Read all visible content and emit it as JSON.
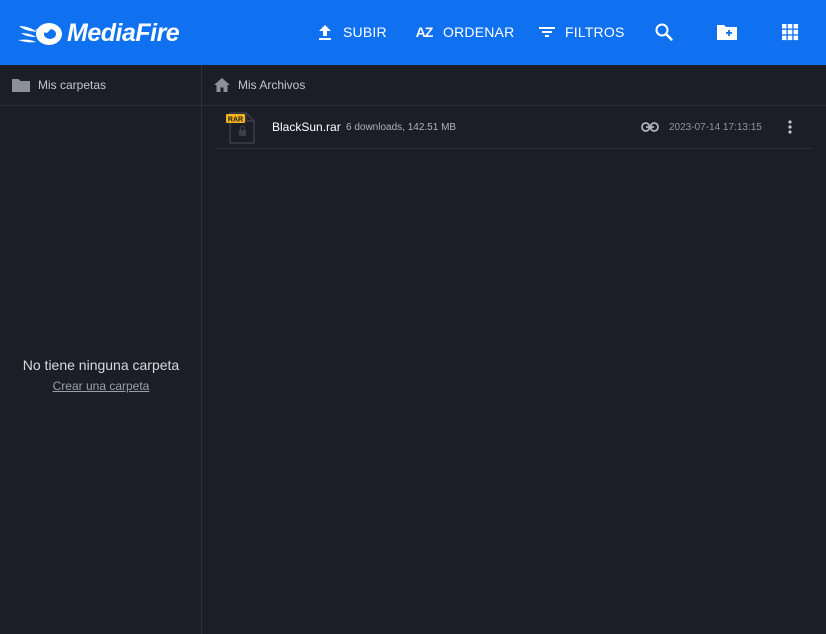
{
  "header": {
    "logo_text": "MediaFire",
    "upload_label": "SUBIR",
    "sort_label": "ORDENAR",
    "filters_label": "FILTROS",
    "sort_icon_text": "AZ",
    "icons": [
      "upload-icon",
      "sort-az-icon",
      "filter-icon",
      "search-icon",
      "new-folder-icon",
      "grid-view-icon"
    ]
  },
  "sidebar": {
    "title": "Mis carpetas",
    "empty_title": "No tiene ninguna carpeta",
    "create_link": "Crear una carpeta"
  },
  "main": {
    "breadcrumb": "Mis Archivos",
    "files": [
      {
        "badge": "RAR",
        "name": "BlackSun.rar",
        "meta": "6 downloads, 142.51 MB",
        "date": "2023-07-14 17:13:15"
      }
    ]
  },
  "colors": {
    "header_bg": "#0f71f0",
    "page_bg": "#1b1e26",
    "divider": "#2d313b",
    "rar_badge": "#f5b21b"
  }
}
